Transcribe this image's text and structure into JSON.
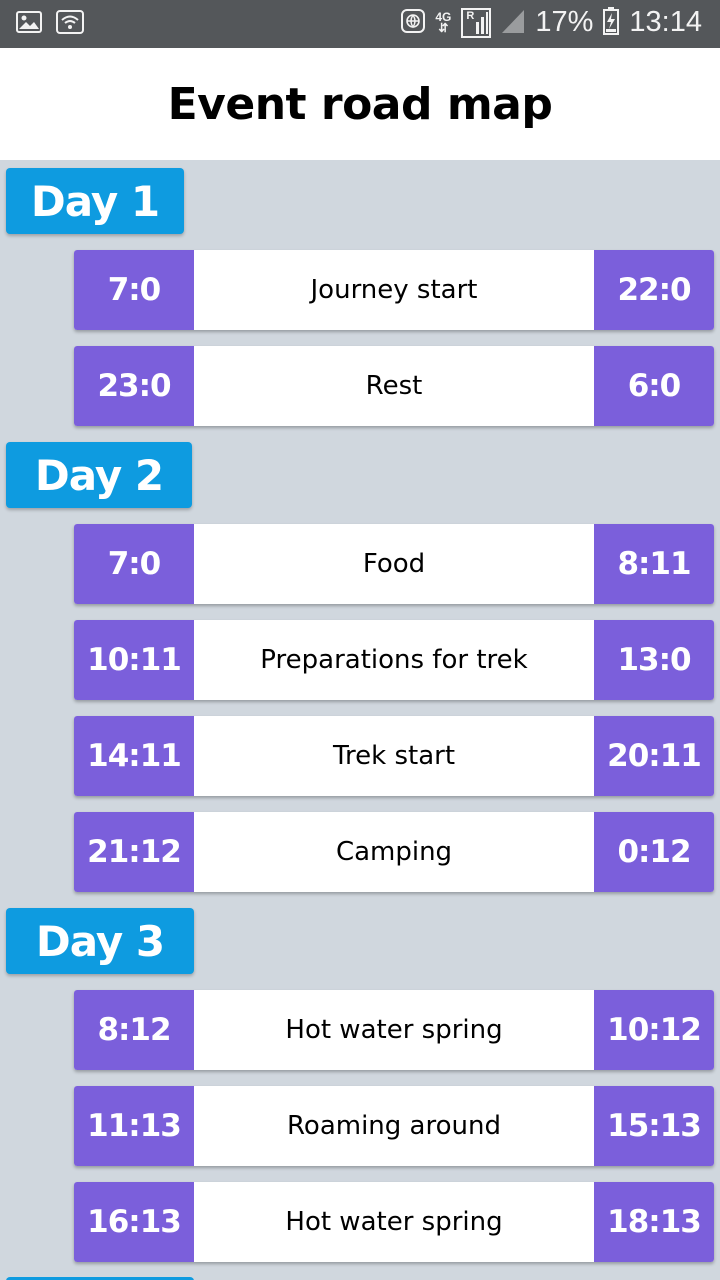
{
  "status_bar": {
    "network": "4G",
    "sim": "R",
    "battery": "17%",
    "time": "13:14",
    "icons": [
      "image-icon",
      "wifi-icon",
      "vpn-globe-icon",
      "signal-icon",
      "signal-empty-icon",
      "battery-charging-icon"
    ]
  },
  "header": {
    "title": "Event road map"
  },
  "days": [
    {
      "label": "Day 1",
      "events": [
        {
          "start": "7:0",
          "name": "Journey start",
          "end": "22:0"
        },
        {
          "start": "23:0",
          "name": "Rest",
          "end": "6:0"
        }
      ]
    },
    {
      "label": "Day 2",
      "events": [
        {
          "start": "7:0",
          "name": "Food",
          "end": "8:11"
        },
        {
          "start": "10:11",
          "name": "Preparations for trek",
          "end": "13:0"
        },
        {
          "start": "14:11",
          "name": "Trek start",
          "end": "20:11"
        },
        {
          "start": "21:12",
          "name": "Camping",
          "end": "0:12"
        }
      ]
    },
    {
      "label": "Day 3",
      "events": [
        {
          "start": "8:12",
          "name": "Hot water spring",
          "end": "10:12"
        },
        {
          "start": "11:13",
          "name": "Roaming around",
          "end": "15:13"
        },
        {
          "start": "16:13",
          "name": "Hot water spring",
          "end": "18:13"
        }
      ]
    }
  ],
  "colors": {
    "day_badge": "#0e9be0",
    "time_box": "#7b5fdb",
    "background": "#d0d7de",
    "status_bar": "#54575a"
  }
}
